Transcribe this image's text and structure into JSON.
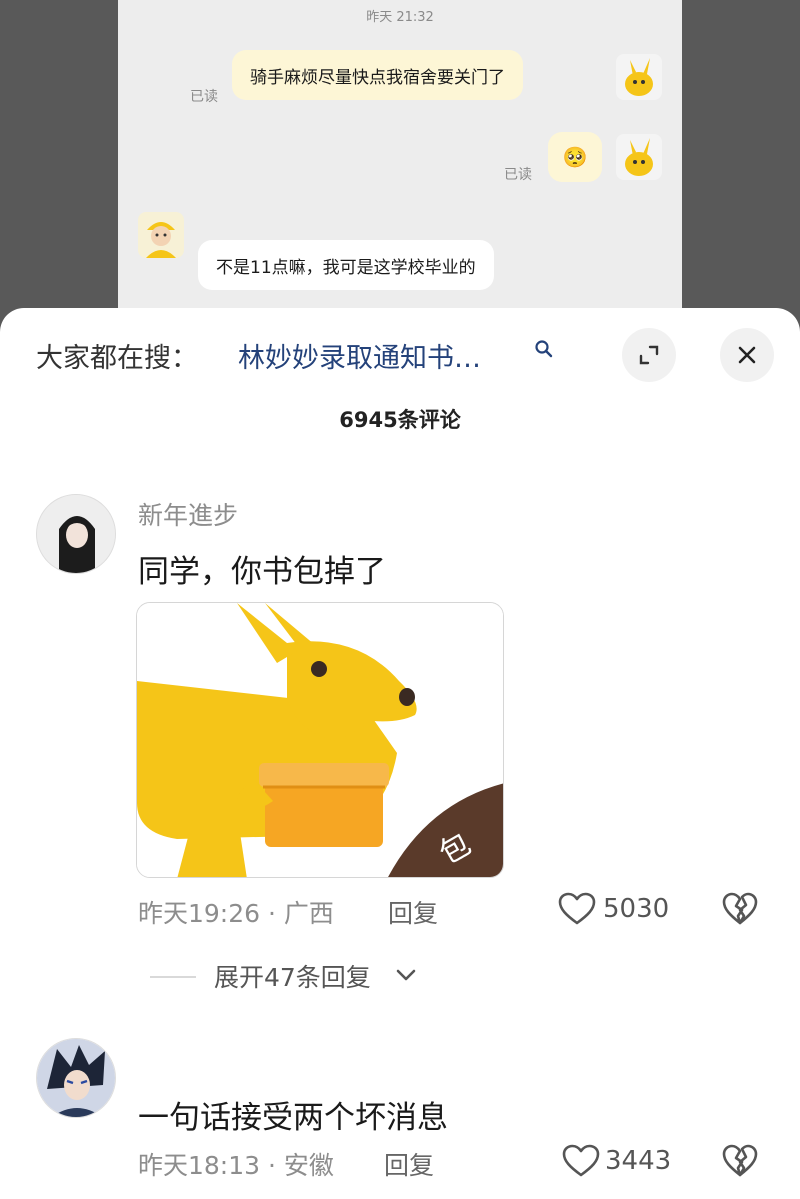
{
  "chat": {
    "time": "昨天 21:32",
    "messages": [
      {
        "text": "骑手麻烦尽量快点我宿舍要关门了",
        "read": "已读"
      },
      {
        "text": "🥺",
        "read": "已读"
      },
      {
        "text": "不是11点嘛，我可是这学校毕业的"
      }
    ]
  },
  "header": {
    "search_label": "大家都在搜：",
    "search_term": "林妙妙录取通知书…",
    "comment_count": "6945条评论"
  },
  "comments": [
    {
      "username": "新年進步",
      "text": "同学，你书包掉了",
      "time_location": "昨天19:26 · 广西",
      "reply": "回复",
      "likes": "5030",
      "expand": "展开47条回复"
    },
    {
      "username": "",
      "text": "一句话接受两个坏消息",
      "time_location": "昨天18:13 · 安徽",
      "reply": "回复",
      "likes": "3443"
    }
  ],
  "colors": {
    "brand_yellow": "#f5c518",
    "box_orange": "#f6a623",
    "link_blue": "#24427a"
  }
}
